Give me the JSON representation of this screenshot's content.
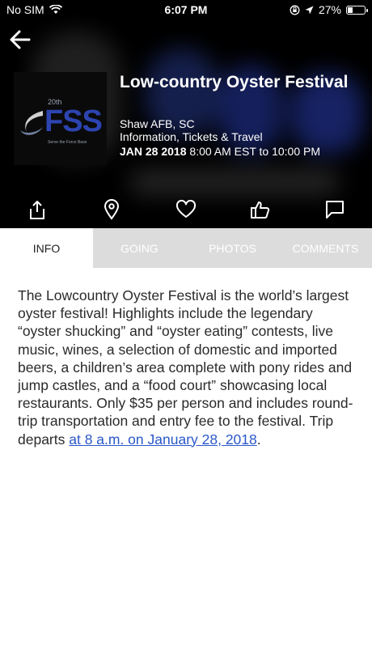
{
  "status_bar": {
    "carrier": "No SIM",
    "time": "6:07 PM",
    "battery": "27%",
    "battery_level": 0.27
  },
  "event": {
    "title": "Low-country Oyster Festival",
    "location": "Shaw AFB, SC",
    "category": "Information, Tickets & Travel",
    "date": "JAN 28 2018",
    "time_range": "8:00 AM EST to 10:00 PM"
  },
  "logo": {
    "text_top": "20th",
    "text_main": "FSS",
    "text_tag": "Serve the Force Base"
  },
  "actions": [
    {
      "name": "share",
      "icon": "share-icon"
    },
    {
      "name": "location",
      "icon": "location-pin-icon"
    },
    {
      "name": "favorite",
      "icon": "heart-icon"
    },
    {
      "name": "like",
      "icon": "thumbs-up-icon"
    },
    {
      "name": "comment",
      "icon": "comment-icon"
    }
  ],
  "tabs": [
    {
      "label": "INFO",
      "active": true
    },
    {
      "label": "GOING",
      "active": false
    },
    {
      "label": "PHOTOS",
      "active": false
    },
    {
      "label": "COMMENTS",
      "active": false
    }
  ],
  "description": {
    "text": "The Lowcountry Oyster Festival is the world’s largest oyster festival! Highlights include the legendary “oyster shucking” and “oyster eating” contests, live music, wines, a selection of domestic and imported beers, a children’s area complete with pony rides and jump castles, and a “food court” showcasing local restaurants. Only $35 per person and includes round-trip transportation and entry fee to the festival. Trip departs ",
    "link": "at 8 a.m. on January 28, 2018",
    "suffix": "."
  },
  "colors": {
    "header_bg": "#000000",
    "tab_inactive_bg": "#dcdcdc",
    "link": "#2a57c8",
    "logo_blue": "#2c44b0"
  }
}
